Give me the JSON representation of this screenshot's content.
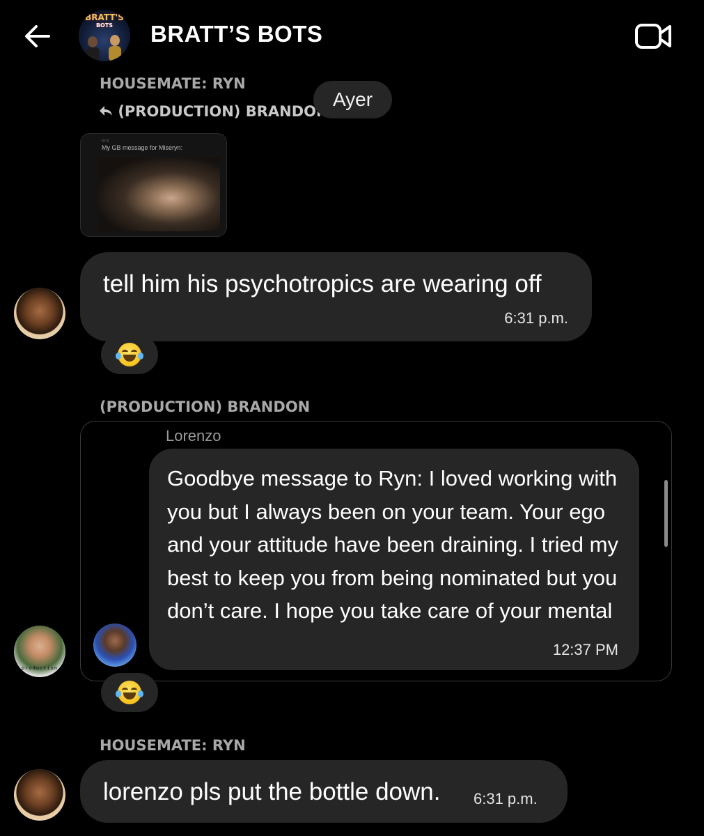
{
  "header": {
    "title": "BRATT’S BOTS",
    "logo_text": "BRATT'S",
    "logo_sub": "BOTS",
    "back_icon": "arrow-left-icon",
    "video_icon": "video-camera-icon"
  },
  "thread": {
    "date_separator": "Ayer",
    "message1": {
      "sender": "HOUSEMATE: RYN",
      "reply_to": "(PRODUCTION) BRANDON",
      "reply_icon": "reply-arrow-icon",
      "thumbnail": {
        "label_small": "Britt",
        "caption": "My GB message for Miseryn:"
      }
    },
    "message2": {
      "text": "tell him his psychotropics are wearing off",
      "time": "6:31 p.m.",
      "reaction": "😂"
    },
    "message3": {
      "sender": "(PRODUCTION) BRANDON",
      "shared": {
        "author": "Lorenzo",
        "text": "Goodbye message to Ryn: I loved working with you but I always been on your team. Your ego and your attitude have been draining. I tried my best to keep you from being nominated but you don’t care. I hope you take care of your mental",
        "time": "12:37 PM"
      },
      "avatar_tag": "production",
      "reaction": "😂"
    },
    "message4": {
      "sender": "HOUSEMATE: RYN",
      "text": "lorenzo pls put the bottle down.",
      "time": "6:31 p.m."
    }
  },
  "colors": {
    "background": "#000000",
    "bubble": "#262626",
    "sender_text": "#a8a8a8"
  }
}
